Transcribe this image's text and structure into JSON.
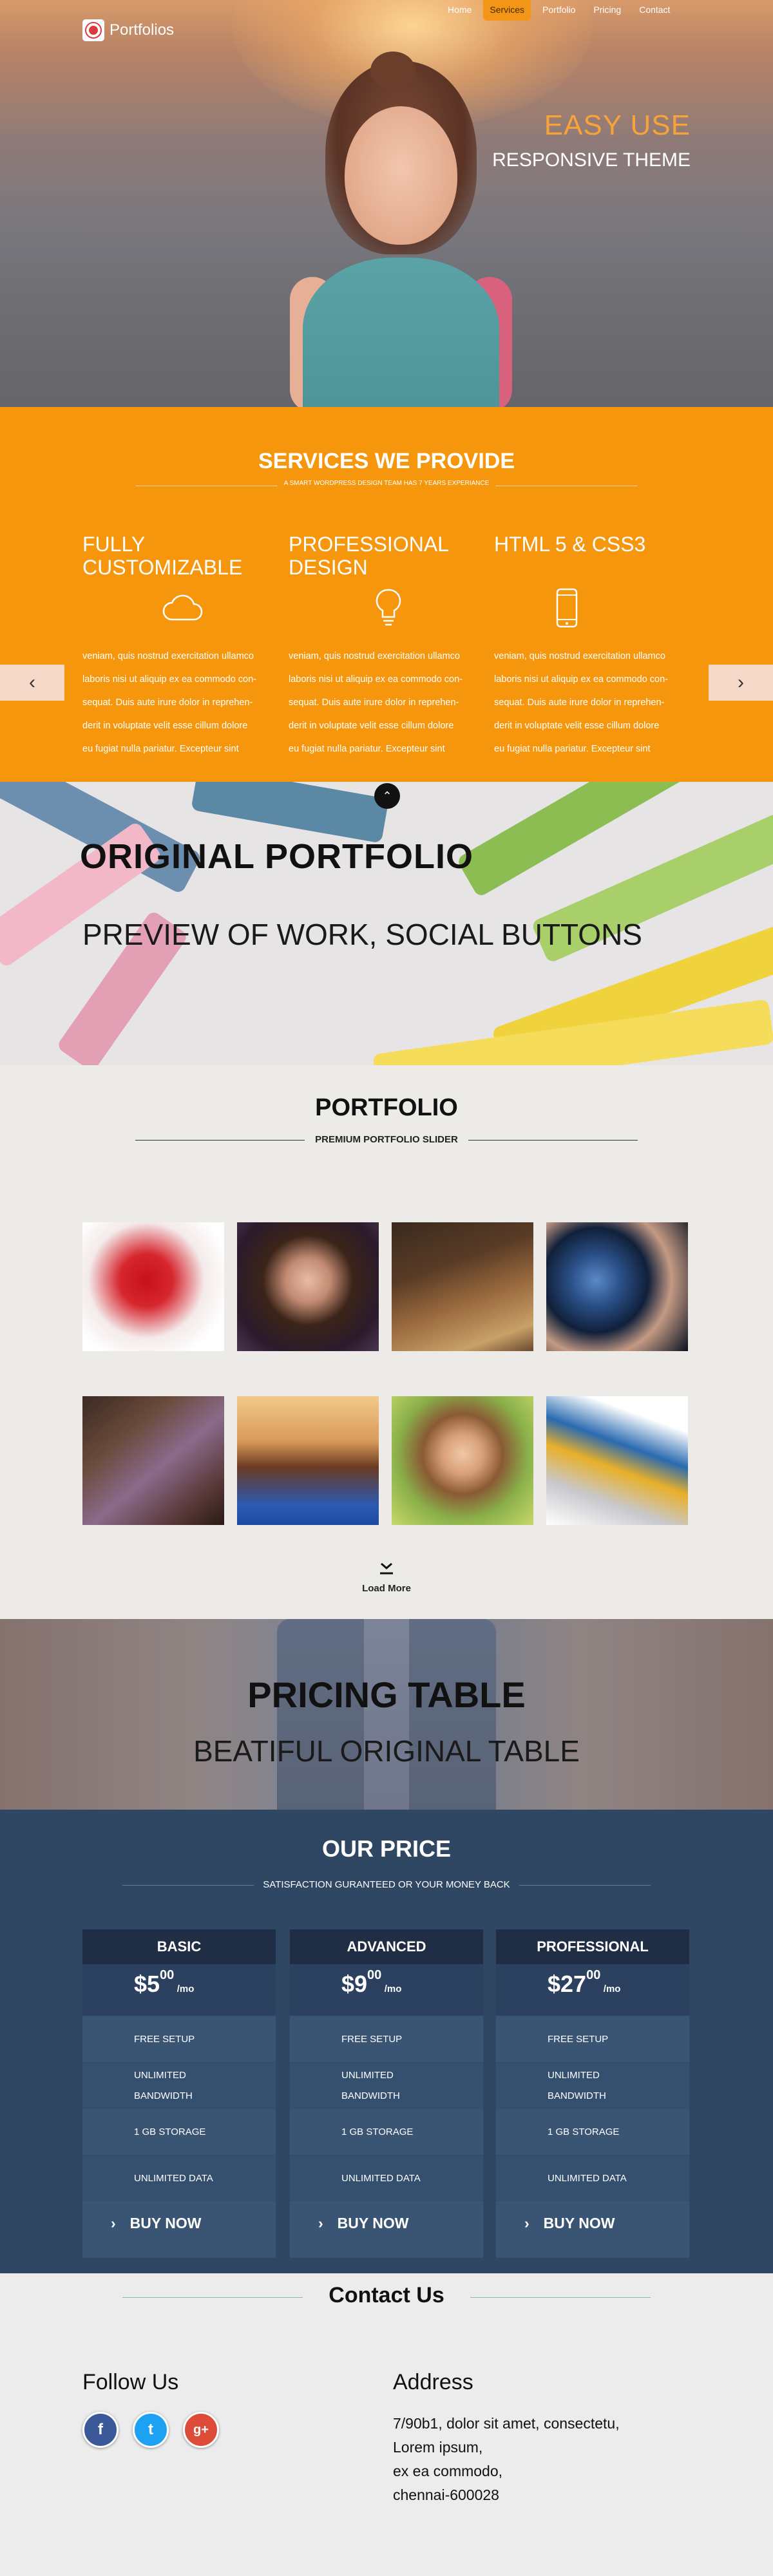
{
  "nav": {
    "logo_text": "Portfolios",
    "items": [
      "Home",
      "Services",
      "Portfolio",
      "Pricing",
      "Contact"
    ],
    "active": "Services"
  },
  "hero": {
    "title": "EASY USE",
    "subtitle": "RESPONSIVE THEME"
  },
  "services": {
    "title": "SERVICES WE PROVIDE",
    "subtitle": "A SMART WORDPRESS DESIGN TEAM HAS 7 YEARS EXPERIANCE",
    "items": [
      {
        "title_line1": "FULLY",
        "title_line2": "CUSTOMIZABLE",
        "icon": "cloud-icon",
        "lines": [
          "veniam, quis nostrud exercitation ullamco",
          "laboris nisi ut aliquip ex ea commodo con-",
          "sequat. Duis aute irure dolor in reprehen-",
          "derit in voluptate velit esse cillum dolore",
          "eu fugiat nulla pariatur. Excepteur sint"
        ]
      },
      {
        "title_line1": "PROFESSIONAL",
        "title_line2": "DESIGN",
        "icon": "lightbulb-icon",
        "lines": [
          "veniam, quis nostrud exercitation ullamco",
          "laboris nisi ut aliquip ex ea commodo con-",
          "sequat. Duis aute irure dolor in reprehen-",
          "derit in voluptate velit esse cillum dolore",
          "eu fugiat nulla pariatur. Excepteur sint"
        ]
      },
      {
        "title_line1": "HTML 5 & CSS3",
        "title_line2": "",
        "icon": "mobile-phone-icon",
        "lines": [
          "veniam, quis nostrud exercitation ullamco",
          "laboris nisi ut aliquip ex ea commodo con-",
          "sequat. Duis aute irure dolor in reprehen-",
          "derit in voluptate velit esse cillum dolore",
          "eu fugiat nulla pariatur. Excepteur sint"
        ]
      }
    ],
    "prev_glyph": "‹",
    "next_glyph": "›"
  },
  "banner_portfolio": {
    "title": "ORIGINAL PORTFOLIO",
    "subtitle": "PREVIEW OF WORK, SOCIAL BUTTONS"
  },
  "portfolio": {
    "title": "PORTFOLIO",
    "subtitle": "PREMIUM PORTFOLIO SLIDER",
    "load_more": "Load More"
  },
  "banner_pricing": {
    "title": "PRICING TABLE",
    "subtitle": "BEATIFUL ORIGINAL TABLE"
  },
  "price": {
    "title": "OUR PRICE",
    "subtitle": "SATISFACTION GURANTEED OR YOUR MONEY BACK",
    "plans": [
      {
        "name": "BASIC",
        "amount": "$5",
        "cents": "00",
        "per": "/mo",
        "button": "BUY NOW"
      },
      {
        "name": "ADVANCED",
        "amount": "$9",
        "cents": "00",
        "per": "/mo",
        "button": "BUY NOW"
      },
      {
        "name": "PROFESSIONAL",
        "amount": "$27",
        "cents": "00",
        "per": "/mo",
        "button": "BUY NOW"
      }
    ],
    "features": [
      "FREE SETUP",
      "UNLIMITED",
      "BANDWIDTH",
      "1 GB STORAGE",
      "UNLIMITED DATA"
    ]
  },
  "contact": {
    "title": "Contact Us",
    "follow_title": "Follow Us",
    "social": [
      {
        "icon": "facebook-icon",
        "glyph": "f",
        "color": "#3b5998"
      },
      {
        "icon": "twitter-icon",
        "glyph": "t",
        "color": "#1da1f2"
      },
      {
        "icon": "google-plus-icon",
        "glyph": "g+",
        "color": "#dd4b39"
      }
    ],
    "address_title": "Address",
    "address_lines": [
      "7/90b1, dolor sit amet, consectetu,",
      "Lorem ipsum,",
      "ex ea commodo,",
      "chennai-600028"
    ]
  },
  "colors": {
    "accent_orange": "#f6960c",
    "price_bg": "#304764",
    "hero_title": "#f8a23a"
  }
}
